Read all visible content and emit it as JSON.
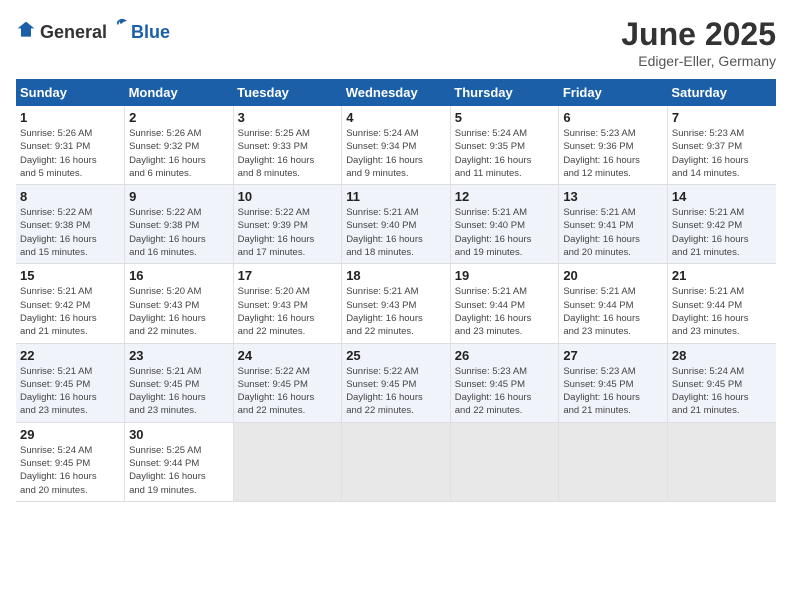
{
  "header": {
    "logo_general": "General",
    "logo_blue": "Blue",
    "title": "June 2025",
    "location": "Ediger-Eller, Germany"
  },
  "days_of_week": [
    "Sunday",
    "Monday",
    "Tuesday",
    "Wednesday",
    "Thursday",
    "Friday",
    "Saturday"
  ],
  "weeks": [
    [
      {
        "day": "1",
        "info": "Sunrise: 5:26 AM\nSunset: 9:31 PM\nDaylight: 16 hours\nand 5 minutes."
      },
      {
        "day": "2",
        "info": "Sunrise: 5:26 AM\nSunset: 9:32 PM\nDaylight: 16 hours\nand 6 minutes."
      },
      {
        "day": "3",
        "info": "Sunrise: 5:25 AM\nSunset: 9:33 PM\nDaylight: 16 hours\nand 8 minutes."
      },
      {
        "day": "4",
        "info": "Sunrise: 5:24 AM\nSunset: 9:34 PM\nDaylight: 16 hours\nand 9 minutes."
      },
      {
        "day": "5",
        "info": "Sunrise: 5:24 AM\nSunset: 9:35 PM\nDaylight: 16 hours\nand 11 minutes."
      },
      {
        "day": "6",
        "info": "Sunrise: 5:23 AM\nSunset: 9:36 PM\nDaylight: 16 hours\nand 12 minutes."
      },
      {
        "day": "7",
        "info": "Sunrise: 5:23 AM\nSunset: 9:37 PM\nDaylight: 16 hours\nand 14 minutes."
      }
    ],
    [
      {
        "day": "8",
        "info": "Sunrise: 5:22 AM\nSunset: 9:38 PM\nDaylight: 16 hours\nand 15 minutes."
      },
      {
        "day": "9",
        "info": "Sunrise: 5:22 AM\nSunset: 9:38 PM\nDaylight: 16 hours\nand 16 minutes."
      },
      {
        "day": "10",
        "info": "Sunrise: 5:22 AM\nSunset: 9:39 PM\nDaylight: 16 hours\nand 17 minutes."
      },
      {
        "day": "11",
        "info": "Sunrise: 5:21 AM\nSunset: 9:40 PM\nDaylight: 16 hours\nand 18 minutes."
      },
      {
        "day": "12",
        "info": "Sunrise: 5:21 AM\nSunset: 9:40 PM\nDaylight: 16 hours\nand 19 minutes."
      },
      {
        "day": "13",
        "info": "Sunrise: 5:21 AM\nSunset: 9:41 PM\nDaylight: 16 hours\nand 20 minutes."
      },
      {
        "day": "14",
        "info": "Sunrise: 5:21 AM\nSunset: 9:42 PM\nDaylight: 16 hours\nand 21 minutes."
      }
    ],
    [
      {
        "day": "15",
        "info": "Sunrise: 5:21 AM\nSunset: 9:42 PM\nDaylight: 16 hours\nand 21 minutes."
      },
      {
        "day": "16",
        "info": "Sunrise: 5:20 AM\nSunset: 9:43 PM\nDaylight: 16 hours\nand 22 minutes."
      },
      {
        "day": "17",
        "info": "Sunrise: 5:20 AM\nSunset: 9:43 PM\nDaylight: 16 hours\nand 22 minutes."
      },
      {
        "day": "18",
        "info": "Sunrise: 5:21 AM\nSunset: 9:43 PM\nDaylight: 16 hours\nand 22 minutes."
      },
      {
        "day": "19",
        "info": "Sunrise: 5:21 AM\nSunset: 9:44 PM\nDaylight: 16 hours\nand 23 minutes."
      },
      {
        "day": "20",
        "info": "Sunrise: 5:21 AM\nSunset: 9:44 PM\nDaylight: 16 hours\nand 23 minutes."
      },
      {
        "day": "21",
        "info": "Sunrise: 5:21 AM\nSunset: 9:44 PM\nDaylight: 16 hours\nand 23 minutes."
      }
    ],
    [
      {
        "day": "22",
        "info": "Sunrise: 5:21 AM\nSunset: 9:45 PM\nDaylight: 16 hours\nand 23 minutes."
      },
      {
        "day": "23",
        "info": "Sunrise: 5:21 AM\nSunset: 9:45 PM\nDaylight: 16 hours\nand 23 minutes."
      },
      {
        "day": "24",
        "info": "Sunrise: 5:22 AM\nSunset: 9:45 PM\nDaylight: 16 hours\nand 22 minutes."
      },
      {
        "day": "25",
        "info": "Sunrise: 5:22 AM\nSunset: 9:45 PM\nDaylight: 16 hours\nand 22 minutes."
      },
      {
        "day": "26",
        "info": "Sunrise: 5:23 AM\nSunset: 9:45 PM\nDaylight: 16 hours\nand 22 minutes."
      },
      {
        "day": "27",
        "info": "Sunrise: 5:23 AM\nSunset: 9:45 PM\nDaylight: 16 hours\nand 21 minutes."
      },
      {
        "day": "28",
        "info": "Sunrise: 5:24 AM\nSunset: 9:45 PM\nDaylight: 16 hours\nand 21 minutes."
      }
    ],
    [
      {
        "day": "29",
        "info": "Sunrise: 5:24 AM\nSunset: 9:45 PM\nDaylight: 16 hours\nand 20 minutes."
      },
      {
        "day": "30",
        "info": "Sunrise: 5:25 AM\nSunset: 9:44 PM\nDaylight: 16 hours\nand 19 minutes."
      },
      {
        "day": "",
        "info": ""
      },
      {
        "day": "",
        "info": ""
      },
      {
        "day": "",
        "info": ""
      },
      {
        "day": "",
        "info": ""
      },
      {
        "day": "",
        "info": ""
      }
    ]
  ]
}
